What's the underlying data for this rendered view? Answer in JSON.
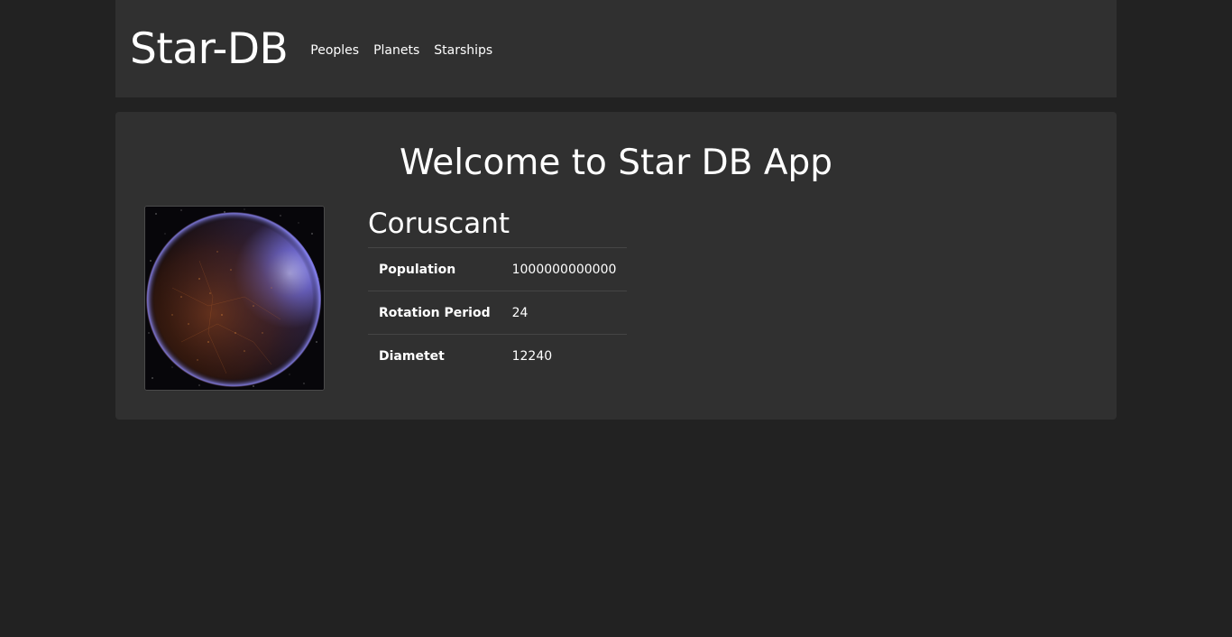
{
  "header": {
    "brand": "Star-DB",
    "nav": [
      {
        "label": "Peoples"
      },
      {
        "label": "Planets"
      },
      {
        "label": "Starships"
      }
    ]
  },
  "main": {
    "welcome": "Welcome to Star DB App",
    "planet": {
      "name": "Coruscant",
      "image_alt": "planet-image",
      "details": [
        {
          "term": "Population",
          "value": "1000000000000"
        },
        {
          "term": "Rotation Period",
          "value": "24"
        },
        {
          "term": "Diametet",
          "value": "12240"
        }
      ]
    }
  },
  "colors": {
    "page_bg": "#222222",
    "panel_bg": "#303030",
    "text": "#ffffff",
    "divider": "#454545"
  }
}
